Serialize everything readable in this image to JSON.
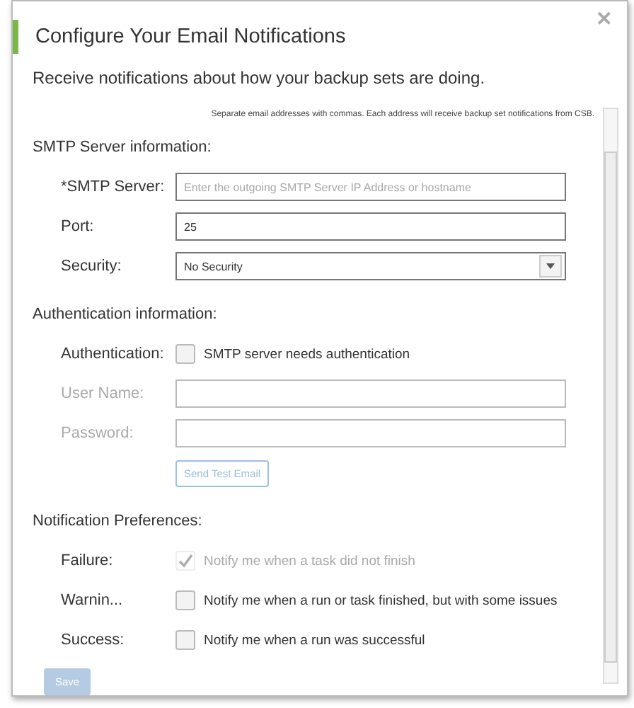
{
  "dialog": {
    "title": "Configure Your Email Notifications",
    "close": "✕"
  },
  "intro": "Receive notifications about how your backup sets are doing.",
  "hint": "Separate email addresses with commas. Each address will receive backup set notifications from CSB.",
  "sections": [
    {
      "heading": "SMTP Server information:",
      "rows": [
        {
          "kind": "text",
          "label": "*SMTP Server:",
          "placeholder": "Enter the outgoing SMTP Server IP Address or hostname",
          "disabled": false
        },
        {
          "kind": "text",
          "label": "Port:",
          "value": "25",
          "disabled": false
        },
        {
          "kind": "select",
          "label": "Security:",
          "value": "No Security"
        }
      ]
    },
    {
      "heading": "Authentication information:",
      "rows": [
        {
          "kind": "checkbox",
          "label": "Authentication:",
          "text": "SMTP server needs authentication",
          "checked": false,
          "disabled": false
        },
        {
          "kind": "text",
          "label": "User Name:",
          "value": "",
          "disabled": true
        },
        {
          "kind": "text",
          "label": "Password:",
          "value": "",
          "disabled": true
        },
        {
          "kind": "button",
          "text": "Send Test Email",
          "disabled": true
        }
      ]
    },
    {
      "heading": "Notification Preferences:",
      "rows": [
        {
          "kind": "checkbox",
          "label": "Failure:",
          "text": "Notify me when a task did not finish",
          "checked": true,
          "disabled": true
        },
        {
          "kind": "checkbox",
          "label": "Warnin...",
          "text": "Notify me when a run or task finished, but with some issues",
          "checked": false,
          "disabled": false
        },
        {
          "kind": "checkbox",
          "label": "Success:",
          "text": "Notify me when a run was successful",
          "checked": false,
          "disabled": false
        }
      ]
    }
  ],
  "save": {
    "text": "Save",
    "disabled": true
  }
}
